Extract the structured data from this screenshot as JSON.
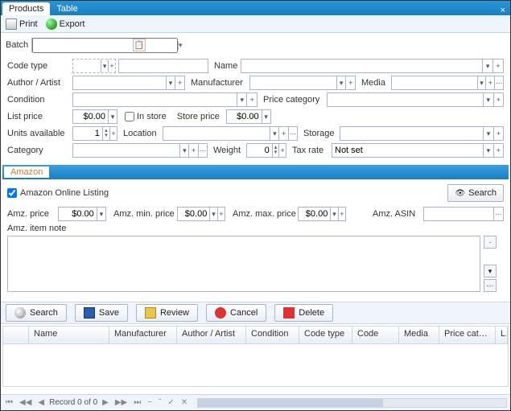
{
  "tabs": {
    "products": "Products",
    "table": "Table"
  },
  "toolbar": {
    "print": "Print",
    "export": "Export"
  },
  "batch": {
    "label": "Batch"
  },
  "labels": {
    "code_type": "Code type",
    "name": "Name",
    "author": "Author / Artist",
    "manufacturer": "Manufacturer",
    "media": "Media",
    "condition": "Condition",
    "price_category": "Price category",
    "list_price": "List price",
    "in_store": "In store",
    "store_price": "Store price",
    "units_available": "Units available",
    "location": "Location",
    "storage": "Storage",
    "category": "Category",
    "weight": "Weight",
    "tax_rate": "Tax rate"
  },
  "values": {
    "list_price": "$0.00",
    "store_price": "$0.00",
    "units_available": "1",
    "weight": "0",
    "tax_rate": "Not set"
  },
  "amazon": {
    "tab": "Amazon",
    "listing_label": "Amazon Online Listing",
    "search": "Search",
    "price_label": "Amz. price",
    "min_price_label": "Amz. min. price",
    "max_price_label": "Amz. max. price",
    "asin_label": "Amz. ASIN",
    "note_label": "Amz. item note",
    "price": "$0.00",
    "min_price": "$0.00",
    "max_price": "$0.00"
  },
  "actions": {
    "search": "Search",
    "save": "Save",
    "review": "Review",
    "cancel": "Cancel",
    "delete": "Delete"
  },
  "grid": {
    "cols": [
      "",
      "Name",
      "Manufacturer",
      "Author / Artist",
      "Condition",
      "Code type",
      "Code",
      "Media",
      "Price categ...",
      "L"
    ]
  },
  "nav": {
    "record": "Record 0 of 0"
  }
}
